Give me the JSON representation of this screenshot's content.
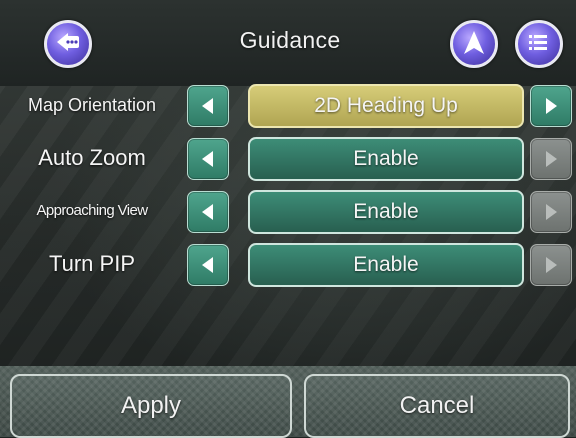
{
  "header": {
    "title": "Guidance",
    "back_icon": "back-more-icon",
    "navigate_icon": "navigation-arrow-icon",
    "menu_icon": "menu-list-icon",
    "accent_color": "#6f5ee0"
  },
  "settings": [
    {
      "label": "Map Orientation",
      "value": "2D Heading Up",
      "selected": true,
      "right_enabled": true
    },
    {
      "label": "Auto Zoom",
      "value": "Enable",
      "selected": false,
      "right_enabled": false
    },
    {
      "label": "Approaching View",
      "value": "Enable",
      "selected": false,
      "right_enabled": false
    },
    {
      "label": "Turn PIP",
      "value": "Enable",
      "selected": false,
      "right_enabled": false
    }
  ],
  "footer": {
    "apply_label": "Apply",
    "cancel_label": "Cancel"
  },
  "colors": {
    "button_green": "#3d8d77",
    "selected_yellow": "#d6cc78",
    "disabled_gray": "#8c918f"
  }
}
